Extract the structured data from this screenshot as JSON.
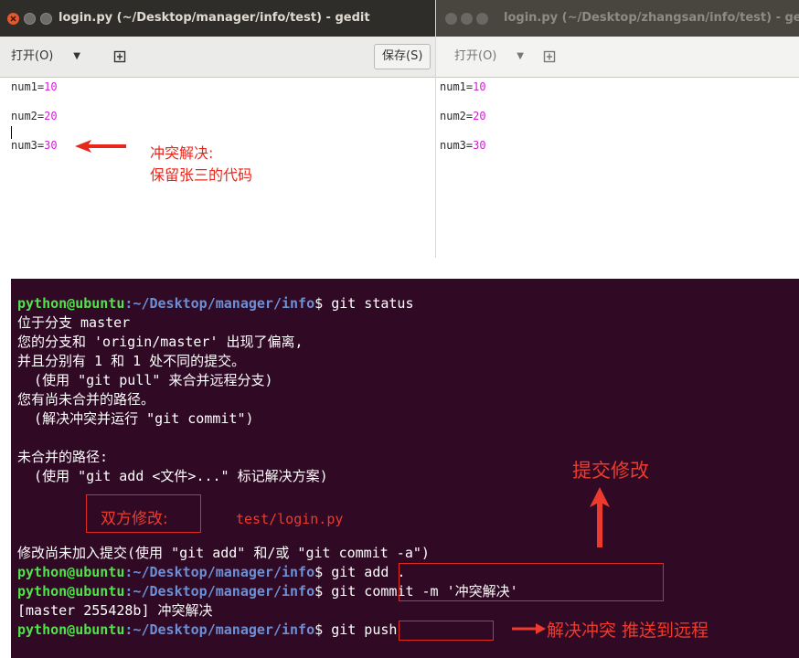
{
  "left_window": {
    "title": "login.py (~/Desktop/manager/info/test) - gedit",
    "open_label": "打开(O)",
    "save_label": "保存(S)",
    "lines": [
      {
        "name": "num1=",
        "value": "10"
      },
      {
        "name": "num2=",
        "value": "20"
      },
      {
        "name": "num3=",
        "value": "30"
      }
    ],
    "note_line1": "冲突解决:",
    "note_line2": "保留张三的代码"
  },
  "right_window": {
    "title": "login.py (~/Desktop/zhangsan/info/test) - gedi",
    "open_label": "打开(O)",
    "lines": [
      {
        "name": "num1=",
        "value": "10"
      },
      {
        "name": "num2=",
        "value": "20"
      },
      {
        "name": "num3=",
        "value": "30"
      }
    ]
  },
  "terminal": {
    "prompt_user": "python@ubuntu",
    "prompt_path": ":~/Desktop/manager/info",
    "prompt_symbol": "$ ",
    "cmd_status": "git status",
    "out1": "位于分支 master",
    "out2": "您的分支和 'origin/master' 出现了偏离,",
    "out3": "并且分别有 1 和 1 处不同的提交。",
    "out4": "  (使用 \"git pull\" 来合并远程分支)",
    "out5": "您有尚未合并的路径。",
    "out6": "  (解决冲突并运行 \"git commit\")",
    "out7": "未合并的路径:",
    "out8": "  (使用 \"git add <文件>...\" 标记解决方案)",
    "conflict_label": "双方修改:",
    "conflict_file": "test/login.py",
    "out9": "修改尚未加入提交(使用 \"git add\" 和/或 \"git commit -a\")",
    "cmd_add": "git add .",
    "cmd_commit": "git commit -m '冲突解决'",
    "out10": "[master 255428b] 冲突解决",
    "cmd_push": "git push",
    "anno_commit": "提交修改",
    "anno_push": "解决冲突 推送到远程"
  }
}
